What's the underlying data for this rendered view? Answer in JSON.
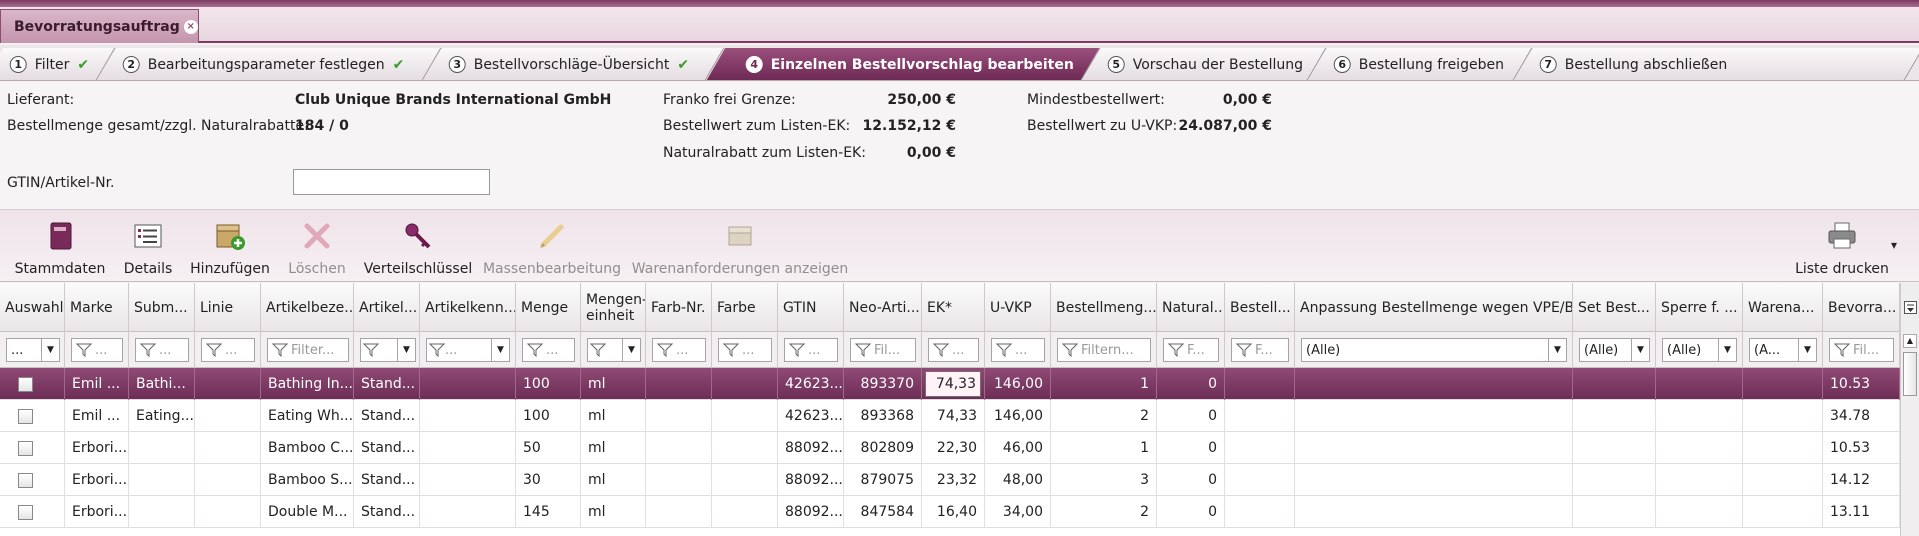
{
  "window": {
    "doc_tab": "Bevorratungsauftrag",
    "close_glyph": "×"
  },
  "wizard": {
    "steps": [
      {
        "num": "1",
        "label": "Filter",
        "done": true
      },
      {
        "num": "2",
        "label": "Bearbeitungsparameter festlegen",
        "done": true
      },
      {
        "num": "3",
        "label": "Bestellvorschläge-Übersicht",
        "done": true
      },
      {
        "num": "4",
        "label": "Einzelnen Bestellvorschlag bearbeiten",
        "active": true
      },
      {
        "num": "5",
        "label": "Vorschau der Bestellung"
      },
      {
        "num": "6",
        "label": "Bestellung freigeben"
      },
      {
        "num": "7",
        "label": "Bestellung abschließen"
      }
    ],
    "check_glyph": "✔"
  },
  "info": {
    "lieferant_label": "Lieferant:",
    "lieferant_value": "Club Unique Brands International GmbH",
    "menge_label": "Bestellmenge gesamt/zzgl. Naturalrabatte:",
    "menge_value": "184 / 0",
    "franko_label": "Franko frei Grenze:",
    "franko_value": "250,00 €",
    "listen_ek_label": "Bestellwert zum Listen-EK:",
    "listen_ek_value": "12.152,12 €",
    "natural_label": "Naturalrabatt zum Listen-EK:",
    "natural_value": "0,00 €",
    "mindest_label": "Mindestbestellwert:",
    "mindest_value": "0,00 €",
    "uvkp_label": "Bestellwert zu U-VKP:",
    "uvkp_value": "24.087,00 €",
    "gtin_label": "GTIN/Artikel-Nr.",
    "gtin_value": ""
  },
  "toolbar": {
    "stammdaten": "Stammdaten",
    "details": "Details",
    "hinzufuegen": "Hinzufügen",
    "loeschen": "Löschen",
    "verteilschluessel": "Verteilschlüssel",
    "massen": "Massenbearbeitung",
    "waren": "Warenanforderungen anzeigen",
    "liste": "Liste drucken",
    "liste_arrow": "▾"
  },
  "grid": {
    "headers": {
      "auswahl": "Auswahl",
      "marke": "Marke",
      "subm": "Subm...",
      "linie": "Linie",
      "artbez": "Artikelbeze...",
      "artikel": "Artikel...",
      "artkenn": "Artikelkenn...",
      "menge": "Menge",
      "mengeneinheit_1": "Mengen-",
      "mengeneinheit_2": "einheit",
      "farbnr": "Farb-Nr.",
      "farbe": "Farbe",
      "gtin": "GTIN",
      "neoart": "Neo-Arti...",
      "ek": "EK*",
      "uvkp": "U-VKP",
      "bestmeng": "Bestellmeng...",
      "natural": "Natural...",
      "bestell": "Bestell...",
      "anpassung": "Anpassung Bestellmenge wegen VPE/BE",
      "setbest": "Set Best...",
      "sperre": "Sperre f. ...",
      "warena": "Warena...",
      "bevorra": "Bevorra..."
    },
    "filters": {
      "auswahl": "...",
      "marke": "...",
      "subm": "...",
      "linie": "...",
      "artbez": "Filter...",
      "artkenn": "...",
      "menge": "...",
      "farbnr": "...",
      "farbe": "...",
      "gtin": "...",
      "neoart": "Fil...",
      "ek": "...",
      "uvkp": "...",
      "bestmeng": "Filtern...",
      "natural": "F...",
      "bestell": "F...",
      "anpassung": "(Alle)",
      "setbest": "(Alle)",
      "sperre": "(Alle)",
      "warena": "(A...",
      "bevorra": "Fil..."
    },
    "rows": [
      {
        "marke": "Emil ...",
        "subm": "Bathi...",
        "linie": "",
        "artbez": "Bathing In...",
        "artikel": "Stand...",
        "artkenn": "",
        "menge": "100",
        "einheit": "ml",
        "farbnr": "",
        "farbe": "",
        "gtin": "42623...",
        "neoart": "893370",
        "ek": "74,33",
        "uvkp": "146,00",
        "bestmeng": "1",
        "natural": "0",
        "bevorra": "10.53"
      },
      {
        "marke": "Emil ...",
        "subm": "Eating...",
        "linie": "",
        "artbez": "Eating Wh...",
        "artikel": "Stand...",
        "artkenn": "",
        "menge": "100",
        "einheit": "ml",
        "farbnr": "",
        "farbe": "",
        "gtin": "42623...",
        "neoart": "893368",
        "ek": "74,33",
        "uvkp": "146,00",
        "bestmeng": "2",
        "natural": "0",
        "bevorra": "34.78"
      },
      {
        "marke": "Erbori...",
        "subm": "",
        "linie": "",
        "artbez": "Bamboo C...",
        "artikel": "Stand...",
        "artkenn": "",
        "menge": "50",
        "einheit": "ml",
        "farbnr": "",
        "farbe": "",
        "gtin": "88092...",
        "neoart": "802809",
        "ek": "22,30",
        "uvkp": "46,00",
        "bestmeng": "1",
        "natural": "0",
        "bevorra": "10.53"
      },
      {
        "marke": "Erbori...",
        "subm": "",
        "linie": "",
        "artbez": "Bamboo S...",
        "artikel": "Stand...",
        "artkenn": "",
        "menge": "30",
        "einheit": "ml",
        "farbnr": "",
        "farbe": "",
        "gtin": "88092...",
        "neoart": "879075",
        "ek": "23,32",
        "uvkp": "48,00",
        "bestmeng": "3",
        "natural": "0",
        "bevorra": "14.12"
      },
      {
        "marke": "Erbori...",
        "subm": "",
        "linie": "",
        "artbez": "Double M...",
        "artikel": "Stand...",
        "artkenn": "",
        "menge": "145",
        "einheit": "ml",
        "farbnr": "",
        "farbe": "",
        "gtin": "88092...",
        "neoart": "847584",
        "ek": "16,40",
        "uvkp": "34,00",
        "bestmeng": "2",
        "natural": "0",
        "bevorra": "13.11"
      }
    ]
  },
  "colors": {
    "accent": "#7e3a66",
    "selected_row": "#7a3860",
    "check": "#3a9a2a"
  }
}
